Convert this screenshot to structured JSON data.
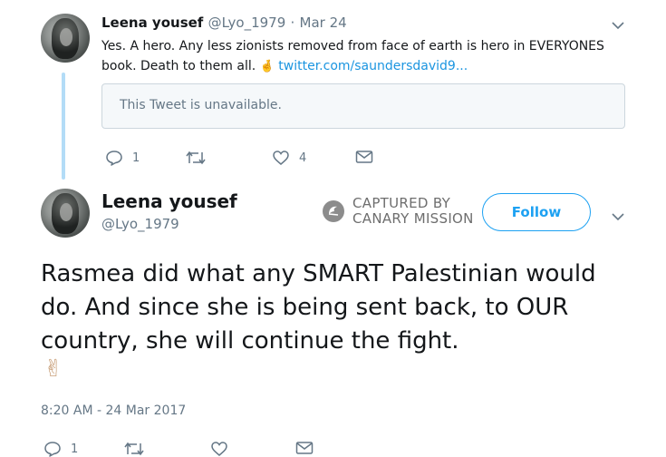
{
  "reply_tweet": {
    "display_name": "Leena yousef",
    "handle": "@Lyo_1979",
    "separator": "·",
    "date": "Mar 24",
    "text": "Yes. A hero. Any less zionists removed from face of earth is hero in EVERYONES book. Death to them all.",
    "emoji": "🤞",
    "link_text": "twitter.com/saundersdavid9...",
    "quoted_unavailable": "This Tweet is unavailable.",
    "actions": {
      "replies": "1",
      "likes": "4"
    }
  },
  "main_tweet": {
    "display_name": "Leena yousef",
    "handle": "@Lyo_1979",
    "follow_label": "Follow",
    "text": "Rasmea did what any SMART Palestinian would do. And since she is being sent back, to OUR country, she will continue the fight.",
    "emoji": "✌",
    "timestamp": "8:20 AM - 24 Mar 2017",
    "actions": {
      "replies": "1"
    }
  },
  "watermark": {
    "line1": "CAPTURED BY",
    "line2": "CANARY MISSION"
  },
  "colors": {
    "accent": "#1da1f2",
    "link": "#1b95e0",
    "muted": "#657786",
    "thread": "#b3dcf7"
  }
}
